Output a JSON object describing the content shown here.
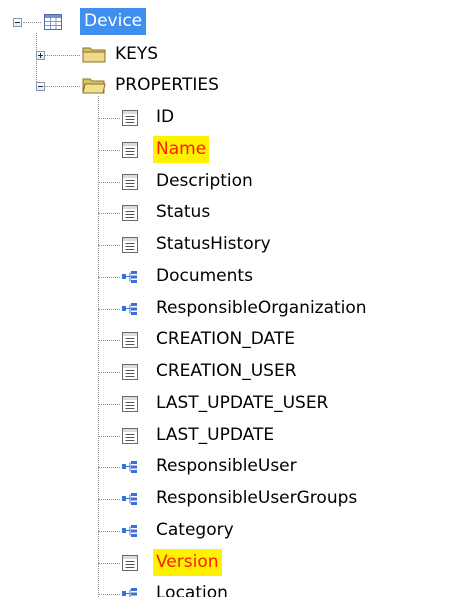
{
  "root": {
    "label": "Device",
    "expanded": true,
    "selected": true
  },
  "nodes": [
    {
      "label": "KEYS",
      "type": "folder",
      "expanded": false
    },
    {
      "label": "PROPERTIES",
      "type": "folder",
      "expanded": true
    }
  ],
  "properties": [
    {
      "label": "ID",
      "type": "attribute",
      "highlighted": false
    },
    {
      "label": "Name",
      "type": "attribute",
      "highlighted": true
    },
    {
      "label": "Description",
      "type": "attribute",
      "highlighted": false
    },
    {
      "label": "Status",
      "type": "attribute",
      "highlighted": false
    },
    {
      "label": "StatusHistory",
      "type": "attribute",
      "highlighted": false
    },
    {
      "label": "Documents",
      "type": "relation",
      "highlighted": false
    },
    {
      "label": "ResponsibleOrganization",
      "type": "relation",
      "highlighted": false
    },
    {
      "label": "CREATION_DATE",
      "type": "attribute",
      "highlighted": false
    },
    {
      "label": "CREATION_USER",
      "type": "attribute",
      "highlighted": false
    },
    {
      "label": "LAST_UPDATE_USER",
      "type": "attribute",
      "highlighted": false
    },
    {
      "label": "LAST_UPDATE",
      "type": "attribute",
      "highlighted": false
    },
    {
      "label": "ResponsibleUser",
      "type": "relation",
      "highlighted": false
    },
    {
      "label": "ResponsibleUserGroups",
      "type": "relation",
      "highlighted": false
    },
    {
      "label": "Category",
      "type": "relation",
      "highlighted": false
    },
    {
      "label": "Version",
      "type": "attribute",
      "highlighted": true
    },
    {
      "label": "Location",
      "type": "relation",
      "highlighted": false
    }
  ],
  "colors": {
    "selection_bg": "#3f8fef",
    "selection_text": "#ffffff",
    "highlight_bg": "#fff200",
    "highlight_text": "#ff1a00"
  }
}
